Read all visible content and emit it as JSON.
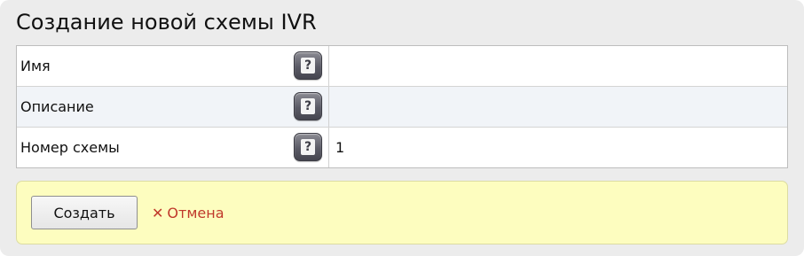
{
  "page": {
    "title": "Создание новой схемы IVR"
  },
  "form": {
    "fields": [
      {
        "label": "Имя",
        "value": "",
        "help_icon": "question-mark-icon"
      },
      {
        "label": "Описание",
        "value": "",
        "help_icon": "question-mark-icon"
      },
      {
        "label": "Номер схемы",
        "value": "1",
        "help_icon": "question-mark-icon"
      }
    ],
    "help_glyph": "?"
  },
  "actions": {
    "create_label": "Создать",
    "cancel_icon": "✕",
    "cancel_label": "Отмена"
  },
  "colors": {
    "panel_bg": "#ececec",
    "alt_row_bg": "#f1f4f8",
    "action_bar_bg": "#fdfdbf",
    "cancel_red": "#c0392b"
  }
}
